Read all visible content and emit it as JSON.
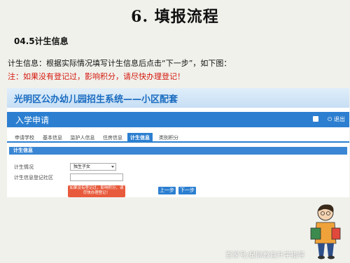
{
  "slide": {
    "title": "6. 填报流程",
    "section_heading": "04.5计生信息",
    "instruction": "计生信息：根据实际情况填写计生信息后点击“下一步”，如下图：",
    "note": "注：如果没有登记过，影响积分，请尽快办理登记！",
    "watermark": "百家号/星际教育升学指导"
  },
  "app": {
    "banner_title": "光明区公办幼儿园招生系统——小区配套",
    "navbar_title": "入学申请",
    "exit_label": "退出",
    "tabs": [
      {
        "label": "申请学校",
        "active": false
      },
      {
        "label": "基本信息",
        "active": false
      },
      {
        "label": "监护人信息",
        "active": false
      },
      {
        "label": "住房信息",
        "active": false
      },
      {
        "label": "计生信息",
        "active": true
      },
      {
        "label": "类别积分",
        "active": false
      }
    ],
    "panel_heading": "计生信息",
    "form": {
      "status_label": "计生情况",
      "status_value": "独生子女",
      "registry_label": "计生信息登记社区",
      "registry_value": ""
    },
    "error_tip": "如果没有登记过，影响积分，请尽快办理登记！",
    "prev_button": "上一步",
    "next_button": "下一步"
  },
  "colors": {
    "accent_blue": "#2c7fd0",
    "warning_red": "#d4180c",
    "tip_orange": "#e85a3c"
  },
  "icons": [
    "home-icon",
    "exit-icon"
  ]
}
